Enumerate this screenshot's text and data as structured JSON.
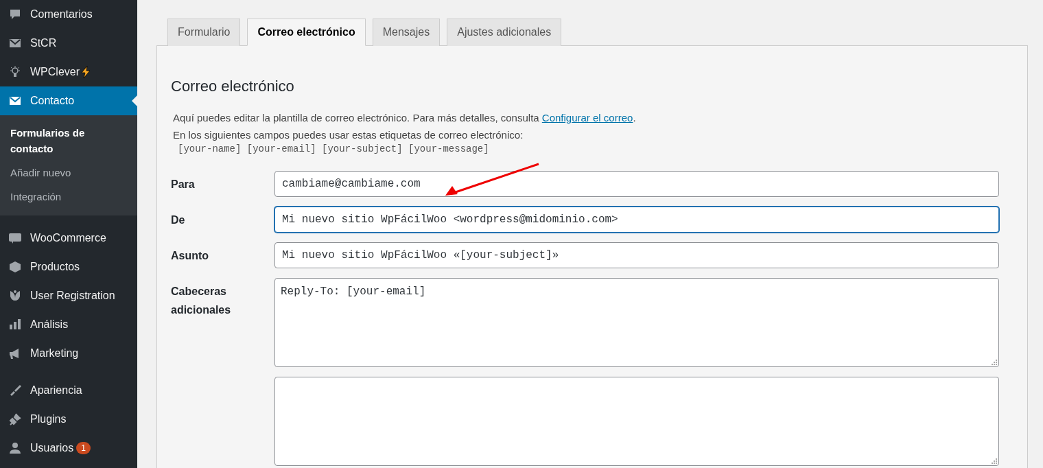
{
  "sidebar": {
    "groups": [
      {
        "items": [
          {
            "label": "Comentarios",
            "selected": false
          },
          {
            "label": "StCR",
            "selected": false
          },
          {
            "label": "WPClever",
            "selected": false,
            "flash": true
          },
          {
            "label": "Contacto",
            "selected": true,
            "children": [
              {
                "label": "Formularios de contacto",
                "selected": true
              },
              {
                "label": "Añadir nuevo",
                "selected": false
              },
              {
                "label": "Integración",
                "selected": false
              }
            ]
          }
        ]
      },
      {
        "items": [
          {
            "label": "WooCommerce",
            "selected": false
          },
          {
            "label": "Productos",
            "selected": false
          },
          {
            "label": "User Registration",
            "selected": false
          },
          {
            "label": "Análisis",
            "selected": false
          },
          {
            "label": "Marketing",
            "selected": false
          }
        ]
      },
      {
        "items": [
          {
            "label": "Apariencia",
            "selected": false
          },
          {
            "label": "Plugins",
            "selected": false
          },
          {
            "label": "Usuarios",
            "selected": false,
            "badge": "1"
          }
        ]
      }
    ]
  },
  "tabs": [
    {
      "label": "Formulario",
      "selected": false
    },
    {
      "label": "Correo electrónico",
      "selected": true
    },
    {
      "label": "Mensajes",
      "selected": false
    },
    {
      "label": "Ajustes adicionales",
      "selected": false
    }
  ],
  "panel": {
    "heading": "Correo electrónico",
    "intro": {
      "text": "Aquí puedes editar la plantilla de correo electrónico. Para más detalles, consulta ",
      "link": "Configurar el correo",
      "after": "."
    },
    "tags_note": "En los siguientes campos puedes usar estas etiquetas de correo electrónico:",
    "tags": "[your-name] [your-email] [your-subject] [your-message]",
    "rows": [
      {
        "kind": "input",
        "label": "Para",
        "value": "cambiame@cambiame.com",
        "focused": false
      },
      {
        "kind": "input",
        "label": "De",
        "value": "Mi nuevo sitio WpFácilWoo <wordpress@midominio.com>",
        "focused": true
      },
      {
        "kind": "input",
        "label": "Asunto",
        "value": "Mi nuevo sitio WpFácilWoo «[your-subject]»",
        "focused": false
      },
      {
        "kind": "textarea",
        "label": "Cabeceras adicionales",
        "value": "Reply-To: [your-email]",
        "focused": false
      },
      {
        "kind": "textarea",
        "focused": false
      }
    ]
  }
}
